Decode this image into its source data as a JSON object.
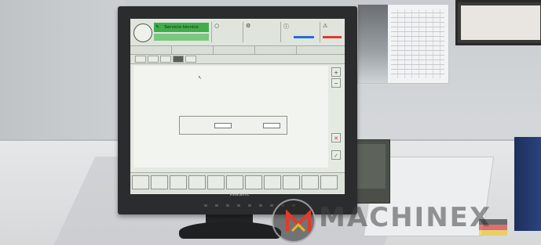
{
  "hmi": {
    "title": "Servicio técnico",
    "status_line": "",
    "cell1_lines": [
      "",
      "",
      ""
    ],
    "cell3_value": "",
    "tabs": [
      "",
      "",
      "",
      "",
      ""
    ],
    "subtabs": [
      "",
      "",
      "",
      "",
      ""
    ],
    "dialog": {
      "title": "",
      "field1_label": "",
      "field1_value": "",
      "field2_label": "",
      "field2_value": ""
    }
  },
  "monitor": {
    "brand": "ViewSonic"
  },
  "watermark": {
    "text": "MACHINEX"
  },
  "colors": {
    "title_green": "#3fae4a",
    "indicator_blue": "#2a6bd6",
    "indicator_red": "#e23a2a",
    "cancel_red": "#d02a2a",
    "confirm_green": "#2b7a2f"
  },
  "icons": [
    "pencil-icon",
    "gear-icon",
    "plus-icon",
    "minus-icon",
    "cancel-icon",
    "confirm-icon",
    "cursor-icon"
  ]
}
